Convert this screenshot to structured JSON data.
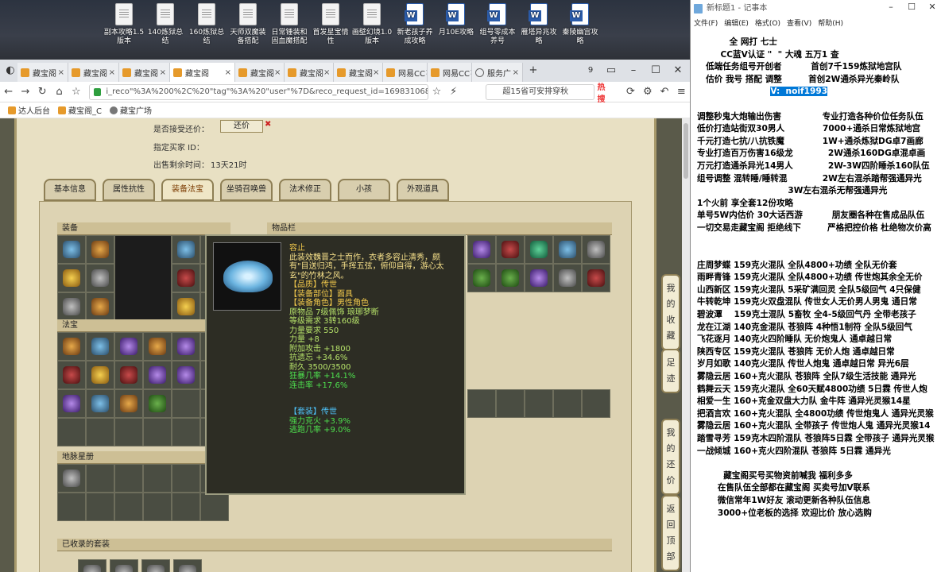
{
  "desktop": {
    "icons": [
      {
        "label": "副本攻略1.5版本",
        "kind": "txt"
      },
      {
        "label": "140炼狱总结",
        "kind": "txt"
      },
      {
        "label": "160炼狱总结",
        "kind": "txt"
      },
      {
        "label": "天师双魔装备搭配",
        "kind": "txt"
      },
      {
        "label": "日常锤装和固血魔搭配",
        "kind": "txt"
      },
      {
        "label": "首发星宝情性",
        "kind": "txt"
      },
      {
        "label": "画壁幻境1.0版本",
        "kind": "txt"
      },
      {
        "label": "新老孩子养成攻略",
        "kind": "doc"
      },
      {
        "label": "月10E攻略",
        "kind": "doc"
      },
      {
        "label": "组号零成本养号",
        "kind": "doc"
      },
      {
        "label": "雁塔异兆攻略",
        "kind": "doc"
      },
      {
        "label": "秦陵幽宫攻略",
        "kind": "doc"
      }
    ]
  },
  "browser": {
    "tabs": [
      {
        "label": "藏宝阁",
        "icon": "treasure-icon"
      },
      {
        "label": "藏宝阁",
        "icon": "treasure-icon"
      },
      {
        "label": "藏宝阁",
        "icon": "treasure-icon"
      },
      {
        "label": "藏宝阁",
        "icon": "treasure-icon",
        "active": true
      },
      {
        "label": "藏宝阁",
        "icon": "treasure-icon"
      },
      {
        "label": "藏宝阁",
        "icon": "treasure-icon"
      },
      {
        "label": "藏宝阁",
        "icon": "treasure-icon"
      },
      {
        "label": "网易CC",
        "icon": "treasure-icon"
      },
      {
        "label": "网易CC",
        "icon": "treasure-icon"
      },
      {
        "label": "服务广",
        "icon": "globe-icon"
      }
    ],
    "tab_count": "9",
    "url": "i_reco\"%3A%200%2C%20\"tag\"%3A%20\"user\"%7D&reco_request_id=1698310685698zzisH",
    "search_text": "超15省可安排穿秋",
    "hot_label": "热搜",
    "bookmarks": [
      "达人后台",
      "藏宝阁_C",
      "藏宝广场"
    ]
  },
  "game": {
    "accept_counter_label": "是否接受还价：",
    "counter_button": "还价",
    "buyer_label": "指定买家 ID：",
    "time_left_label": "出售剩余时间：",
    "time_left_value": "13天21时",
    "tabs": [
      "基本信息",
      "属性抗性",
      "装备法宝",
      "坐骑召唤兽",
      "法术修正",
      "小孩",
      "外观道具"
    ],
    "active_tab": "装备法宝",
    "sections": {
      "equip": "装备",
      "items": "物品栏",
      "fabao": "法宝",
      "dimai": "地脉星册",
      "collected": "已收录的套装"
    },
    "side_buttons": [
      "我的收藏",
      "足迹",
      "我的还价",
      "返回顶部"
    ]
  },
  "tooltip": {
    "name": "容止",
    "desc": "此装效魏晋之士而作，衣者多容止清秀，颇有\"目送归鸿，手挥五弦，俯仰自得，游心太玄\"的竹林之风。",
    "quality": "【品质】传世",
    "part": "【装备部位】面具",
    "role": "【装备角色】男性角色",
    "lines": [
      "原物品 7级佩饰 琅琊梦断",
      "等级需求 3转160级",
      "力量要求 550",
      "力量 +8",
      "附加攻击 +1800",
      "抗遗忘 +34.6%",
      "耐久 3500/3500"
    ],
    "green_lines": [
      "狂暴几率 +14.1%",
      "连击率 +17.6%"
    ],
    "set_title": "【套装】传世",
    "set_lines": [
      "强力克火 +3.9%",
      "逃跑几率 +9.0%"
    ]
  },
  "notepad": {
    "title": "新标题1 - 记事本",
    "menu": [
      "文件(F)",
      "编辑(E)",
      "格式(O)",
      "查看(V)",
      "帮助(H)"
    ],
    "lines": [
      "           全 网打 七士",
      "        CC蓝V认证 \"  \" 大魂 五万1 查",
      "   低端任务组号开创者          首创7千159炼狱地宫队",
      "   估价 我号 搭配 调整         首创2W通杀异光秦岭队",
      "                         V:  noif1993",
      "",
      "调整秒鬼大炮输出伤害              专业打造各种价位任务队伍",
      "低价打造站街双30男人             7000+通杀日常炼狱地宫",
      "千元打造七抗/八抗铁魔             1W+通杀炼狱DG卓7画廊",
      "专业打造百万伤害16级龙            2W通杀160DG卓混卓画",
      "万元打造通杀异光14男人            2W-3W四阶睡杀160队伍",
      "组号调整 混转睡/睡转混            2W左右混杀踏帮强通异光",
      "                               3W左右混杀无帮强通异光",
      "1个火前 享全套12份攻略",
      "单号5W内估价 30大话西游          朋友圈各种在售成品队伍",
      "一切交易走藏宝阁 拒绝线下         严格把控价格 杜绝物次价高",
      "",
      "",
      "庄周梦蝶 159克火混队 全队4800+功绩 全队无价套",
      "雨畔青锋 159克火混队 全队4800+功绩 传世炮其余全无价",
      "山西新区 159克火混队 5采矿满回灵 全队5级回气 4只保健",
      "牛转乾坤 159克火双盘混队 传世女人无价男人男鬼 通日常",
      "碧波潭    159克土混队 5畜牧 全4-5级回气丹 全带老孩子",
      "龙在江湖 140克金混队 苍狼阵 4种悟1制符 全队5级回气",
      "飞花逐月 140克火四阶睡队 无价炮鬼人 通卓越日常",
      "陕西专区 159克火混队 苍狼阵 无价人炮 通卓越日常",
      "岁月如歌 140克火混队 传世人炮鬼 通卓越日常 异光6层",
      "雾隐云居 160+克火混队 苍狼阵 全队7级生活技能 通异光",
      "鹤舞云天 159克火混队 全60天赋4800功绩 5日霖 传世人炮",
      "相爱一生 160+克金双盘大力队 金牛阵 通异光灵猴14星",
      "把酒言欢 160+克火混队 全4800功绩 传世炮鬼人 通异光灵猴",
      "雾隐云居 160+克火混队 全带孩子 传世炮人鬼 通异光灵猴14",
      "踏雪寻芳 159克木四阶混队 苍狼阵5日霖 全带孩子 通异光灵猴",
      "一战倾城 160+克火四阶混队 苍狼阵 5日霖 通异光",
      "",
      "         藏宝阁买号买物资前喊我 福利多多",
      "       在售队伍全部都在藏宝阁 买卖号加V联系",
      "       微信常年1W好友 滚动更新各种队伍信息",
      "       3000+位老板的选择 欢迎比价 放心选购"
    ]
  }
}
